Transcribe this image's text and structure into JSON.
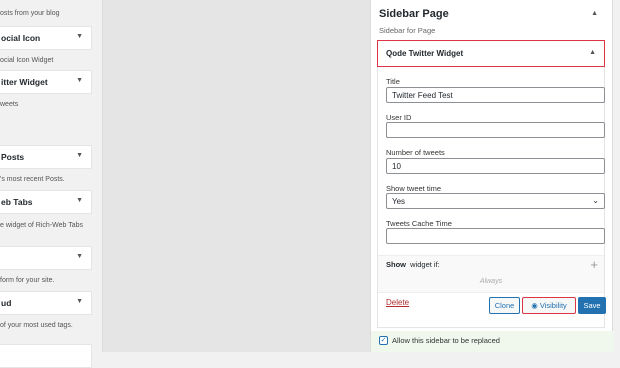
{
  "left_widgets": {
    "recent_posts_desc_tail": "osts from your blog",
    "social_icon_title": "ocial Icon",
    "social_icon_desc": "ocial Icon Widget",
    "twitter_title": "itter Widget",
    "twitter_desc": "weets",
    "posts_title": "Posts",
    "posts_desc": "'s most recent Posts.",
    "tabs_title": "eb Tabs",
    "tabs_desc": "e widget of Rich-Web Tabs",
    "form_desc": "form for your site.",
    "cloud_title": "ud",
    "cloud_desc": "of your most used tags."
  },
  "sidebar": {
    "title": "Sidebar Page",
    "subtitle": "Sidebar for Page",
    "widget_title": "Qode Twitter Widget",
    "fields": {
      "title_label": "Title",
      "title_value": "Twitter Feed Test",
      "user_id_label": "User ID",
      "user_id_value": "",
      "num_tweets_label": "Number of tweets",
      "num_tweets_value": "10",
      "show_time_label": "Show tweet time",
      "show_time_value": "Yes",
      "cache_time_label": "Tweets Cache Time",
      "cache_time_value": ""
    },
    "show_label_bold": "Show",
    "show_label_rest": "widget if:",
    "always_text": "Always",
    "delete_label": "Delete",
    "clone_label": "Clone",
    "visibility_label": "Visibility",
    "save_label": "Save",
    "replace_label": "Allow this sidebar to be replaced",
    "replace_checked": true
  },
  "colors": {
    "accent": "#2271b1",
    "highlight": "#dc3545",
    "delete": "#b32d2e"
  },
  "icons": {
    "collapse": "triangle-up-icon",
    "expand": "triangle-down-icon",
    "add": "plus-icon",
    "visibility": "eye-icon",
    "check": "checkmark-icon"
  }
}
